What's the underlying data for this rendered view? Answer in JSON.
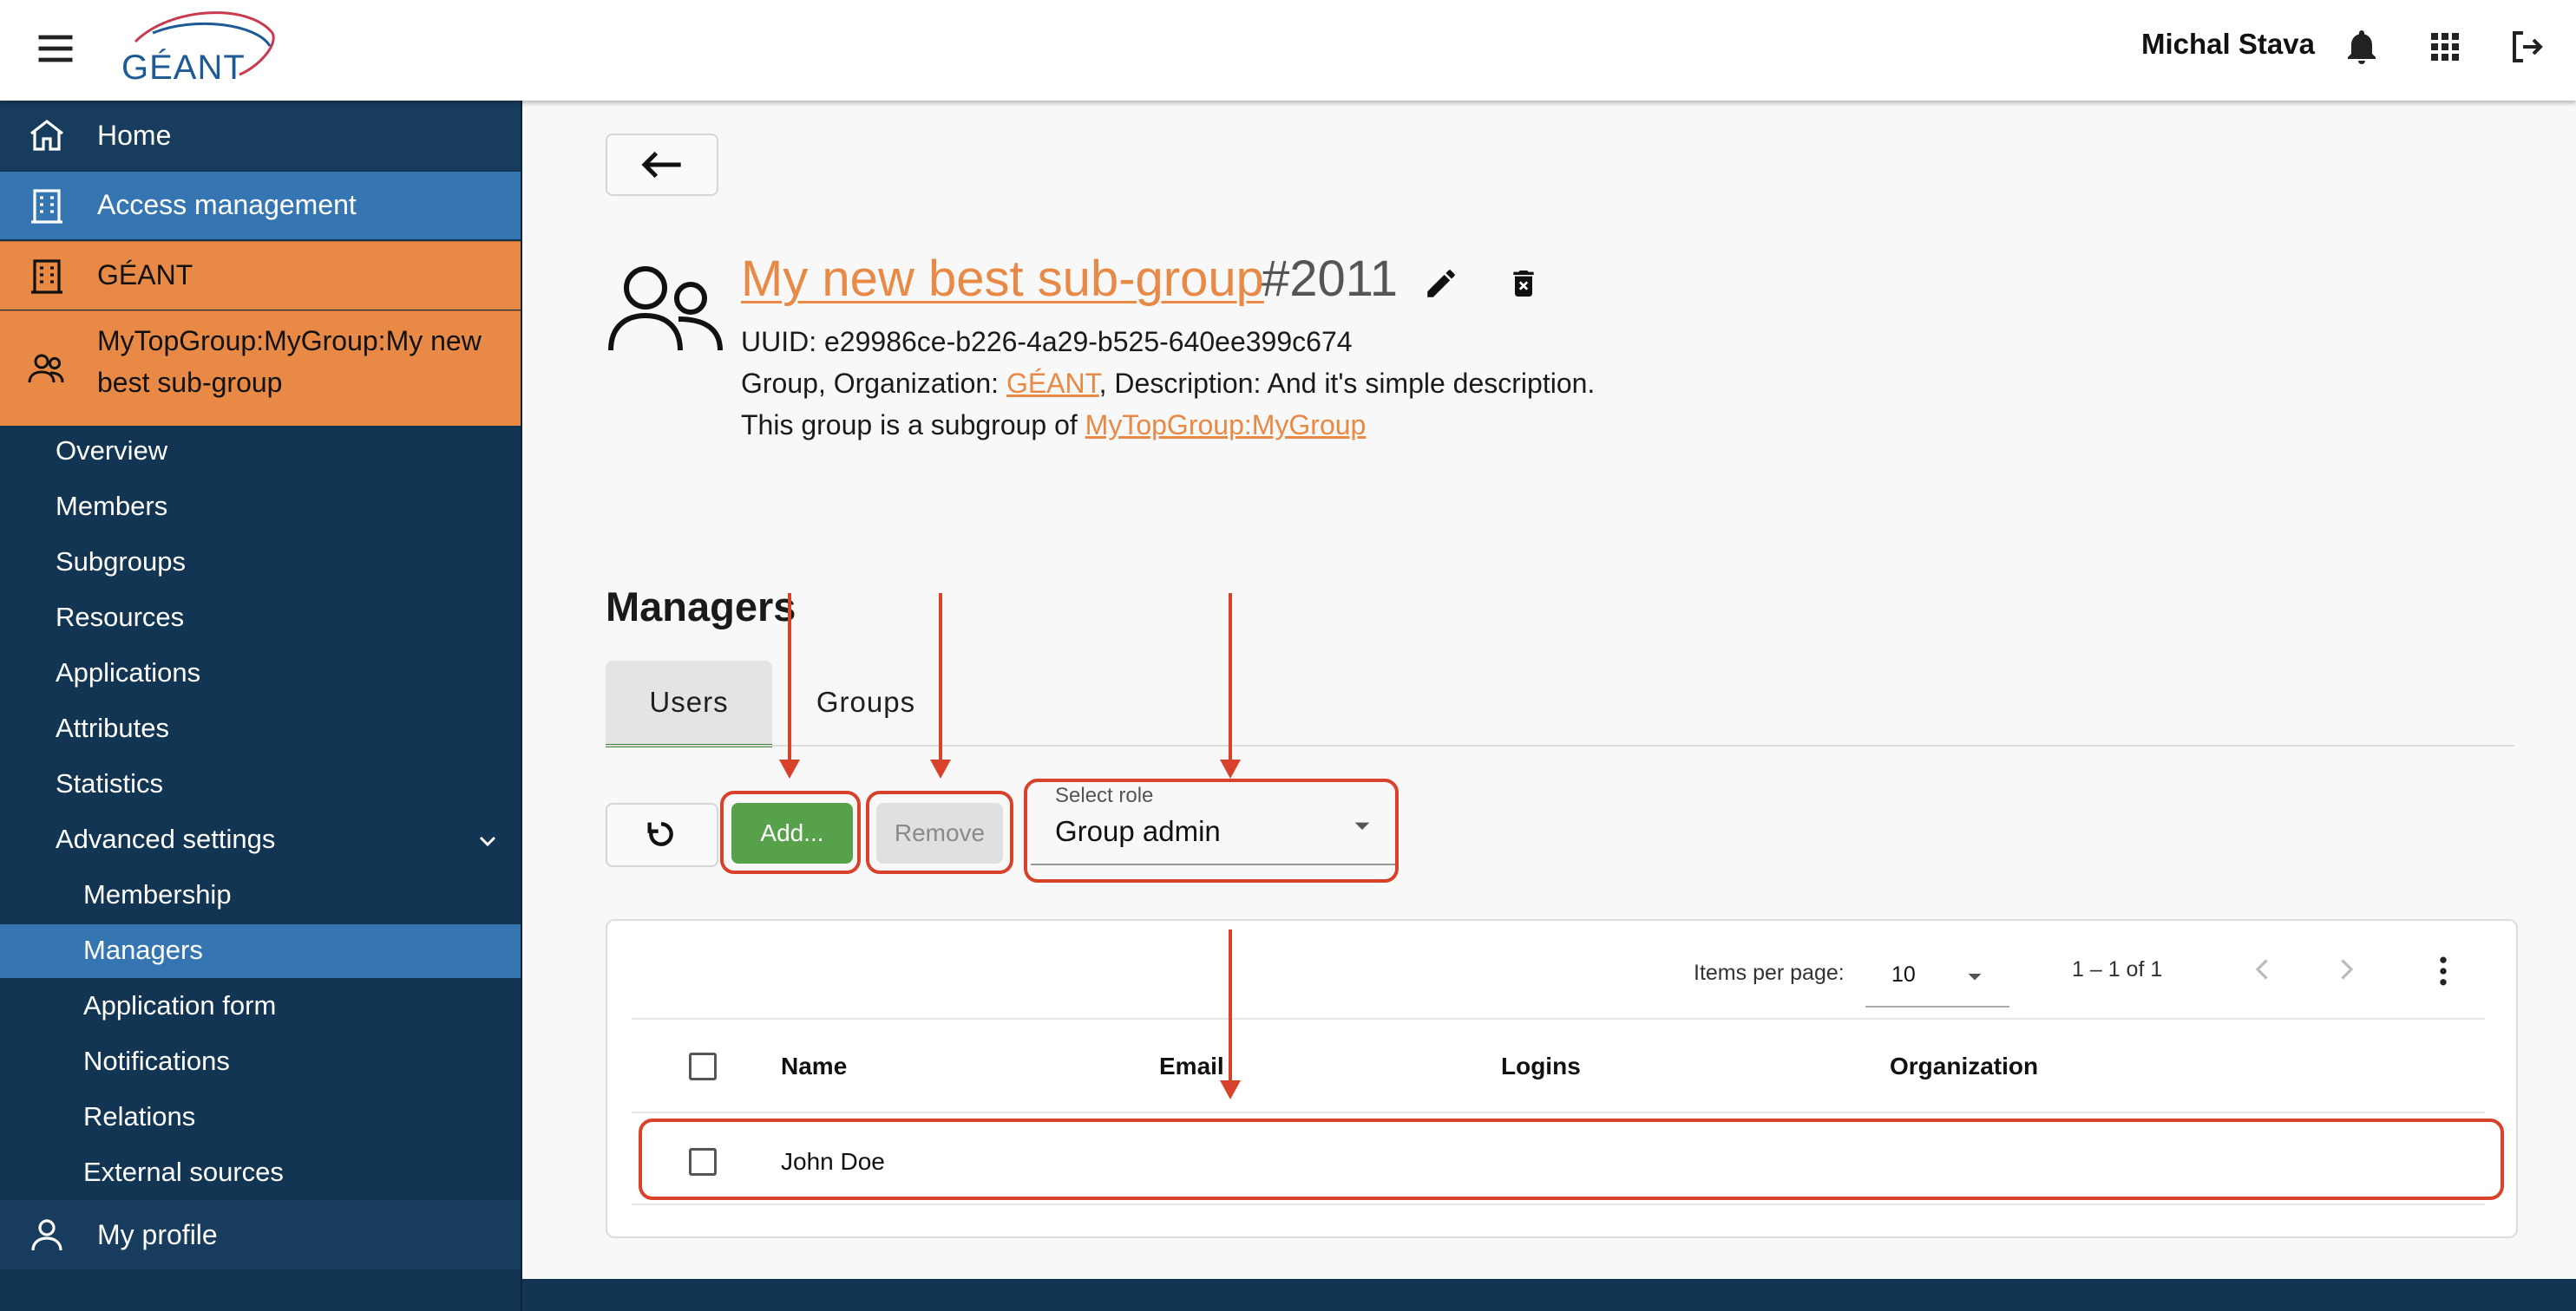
{
  "header": {
    "logo_text": "GÉANT",
    "user_name": "Michal Stava"
  },
  "sidebar": {
    "home": "Home",
    "access": "Access management",
    "org": "GÉANT",
    "group_line1": "MyTopGroup:MyGroup:My new",
    "group_line2": "best sub-group",
    "items": [
      "Overview",
      "Members",
      "Subgroups",
      "Resources",
      "Applications",
      "Attributes",
      "Statistics",
      "Advanced settings"
    ],
    "advanced_items": [
      "Membership",
      "Managers",
      "Application form",
      "Notifications",
      "Relations",
      "External sources"
    ],
    "profile": "My profile"
  },
  "group": {
    "title": "My new best sub-group",
    "id": "#2011",
    "uuid_line": "UUID: e29986ce-b226-4a29-b525-640ee399c674",
    "org_prefix": "Group, Organization: ",
    "org_link": "GÉANT",
    "desc_suffix": ", Description: And it's simple description.",
    "subgroup_prefix": "This group is a subgroup of ",
    "parent_link": "MyTopGroup:MyGroup"
  },
  "managers": {
    "title": "Managers",
    "tabs": [
      "Users",
      "Groups"
    ],
    "add_label": "Add...",
    "remove_label": "Remove",
    "role_label": "Select role",
    "role_value": "Group admin",
    "items_per_page_label": "Items per page:",
    "items_per_page": "10",
    "range": "1 – 1 of 1",
    "columns": [
      "Name",
      "Email",
      "Logins",
      "Organization"
    ],
    "rows": [
      {
        "name": "John Doe",
        "email": "",
        "logins": "",
        "organization": ""
      }
    ]
  },
  "colors": {
    "sidebar_bg": "#123553",
    "active_blue": "#3576b2",
    "orange": "#e88a45",
    "add_green": "#58a14b",
    "annotation_red": "#d8412a"
  },
  "icons": [
    "menu-icon",
    "geant-logo",
    "bell-icon",
    "apps-grid-icon",
    "logout-icon",
    "home-icon",
    "building-icon",
    "group-icon",
    "chevron-down-icon",
    "person-icon",
    "arrow-left-icon",
    "edit-icon",
    "delete-icon",
    "refresh-icon",
    "dropdown-arrow-icon",
    "chevron-left-icon",
    "chevron-right-icon",
    "more-vert-icon"
  ]
}
